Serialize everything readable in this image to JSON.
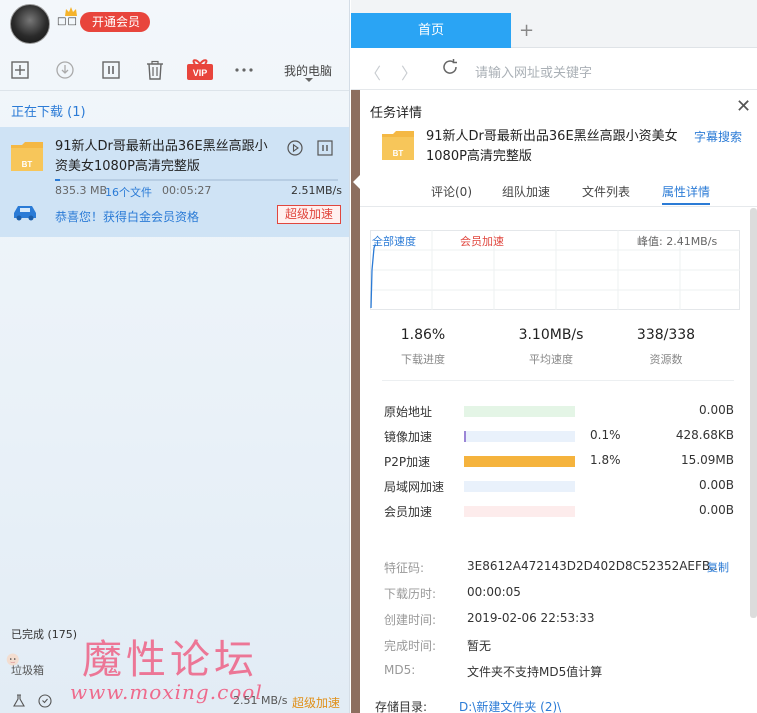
{
  "user": {
    "name": "□□",
    "vip_button": "开通会员"
  },
  "toolbar": {
    "my_pc": "我的电脑"
  },
  "downloading": {
    "section_title": "正在下载 (1)",
    "task": {
      "name": "91新人Dr哥最新出品36E黑丝高跟小资美女1080P高清完整版",
      "size": "835.3 MB",
      "files": "16个文件",
      "elapsed": "00:05:27",
      "speed": "2.51MB/s",
      "progress": 0.0186,
      "congrats": "恭喜您！获得白金会员资格",
      "super_accel_button": "超级加速",
      "folder_badge": "BT"
    }
  },
  "left_bottom": {
    "completed": "已完成 (175)",
    "trash": "垃圾箱",
    "speed": "2.51 MB/s",
    "super_accel": "超级加速"
  },
  "watermark": {
    "title": "魔性论坛",
    "url": "www.moxing.cool"
  },
  "browser": {
    "active_tab": "首页",
    "new_tab": "+",
    "back": "〈",
    "forward": "〉",
    "address_placeholder": "请输入网址或关键字"
  },
  "detail": {
    "title": "任务详情",
    "close": "✕",
    "name": "91新人Dr哥最新出品36E黑丝高跟小资美女1080P高清完整版",
    "subtitle_link": "字幕搜索",
    "tabs": [
      {
        "label": "评论(0)"
      },
      {
        "label": "组队加速"
      },
      {
        "label": "文件列表"
      },
      {
        "label": "属性详情"
      }
    ],
    "legend_all": "全部速度",
    "legend_vip": "会员加速",
    "peak": "峰值:  2.41MB/s",
    "stats": [
      {
        "value": "1.86%",
        "label": "下载进度"
      },
      {
        "value": "3.10MB/s",
        "label": "平均速度"
      },
      {
        "value": "338/338",
        "label": "资源数"
      }
    ],
    "sources": [
      {
        "label": "原始地址",
        "percent": "",
        "fraction": 0,
        "size": "0.00B",
        "color": "#e4f5e6"
      },
      {
        "label": "镜像加速",
        "percent": "0.1%",
        "fraction": 0.02,
        "size": "428.68KB",
        "color": "#9b86d6"
      },
      {
        "label": "P2P加速",
        "percent": "1.8%",
        "fraction": 1.0,
        "size": "15.09MB",
        "color": "#f5b33d"
      },
      {
        "label": "局域网加速",
        "percent": "",
        "fraction": 0,
        "size": "0.00B",
        "color": "#e9f1fb"
      },
      {
        "label": "会员加速",
        "percent": "",
        "fraction": 0,
        "size": "0.00B",
        "color": "#fdecec"
      }
    ],
    "info": [
      {
        "label": "特征码:",
        "value": "3E8612A472143D2D402D8C52352AEFB..."
      },
      {
        "label": "下载历时:",
        "value": "00:00:05"
      },
      {
        "label": "创建时间:",
        "value": "2019-02-06 22:53:33"
      },
      {
        "label": "完成时间:",
        "value": "暂无"
      },
      {
        "label": "MD5:",
        "value": "文件夹不支持MD5值计算"
      }
    ],
    "copy_link": "复制",
    "storage_label": "存储目录:",
    "storage_value": "D:\\新建文件夹 (2)\\"
  },
  "colors": {
    "accent": "#2b7bd6",
    "tab_blue": "#2aa4f4",
    "vip_red": "#e8453c",
    "p2p_orange": "#f5b33d"
  }
}
